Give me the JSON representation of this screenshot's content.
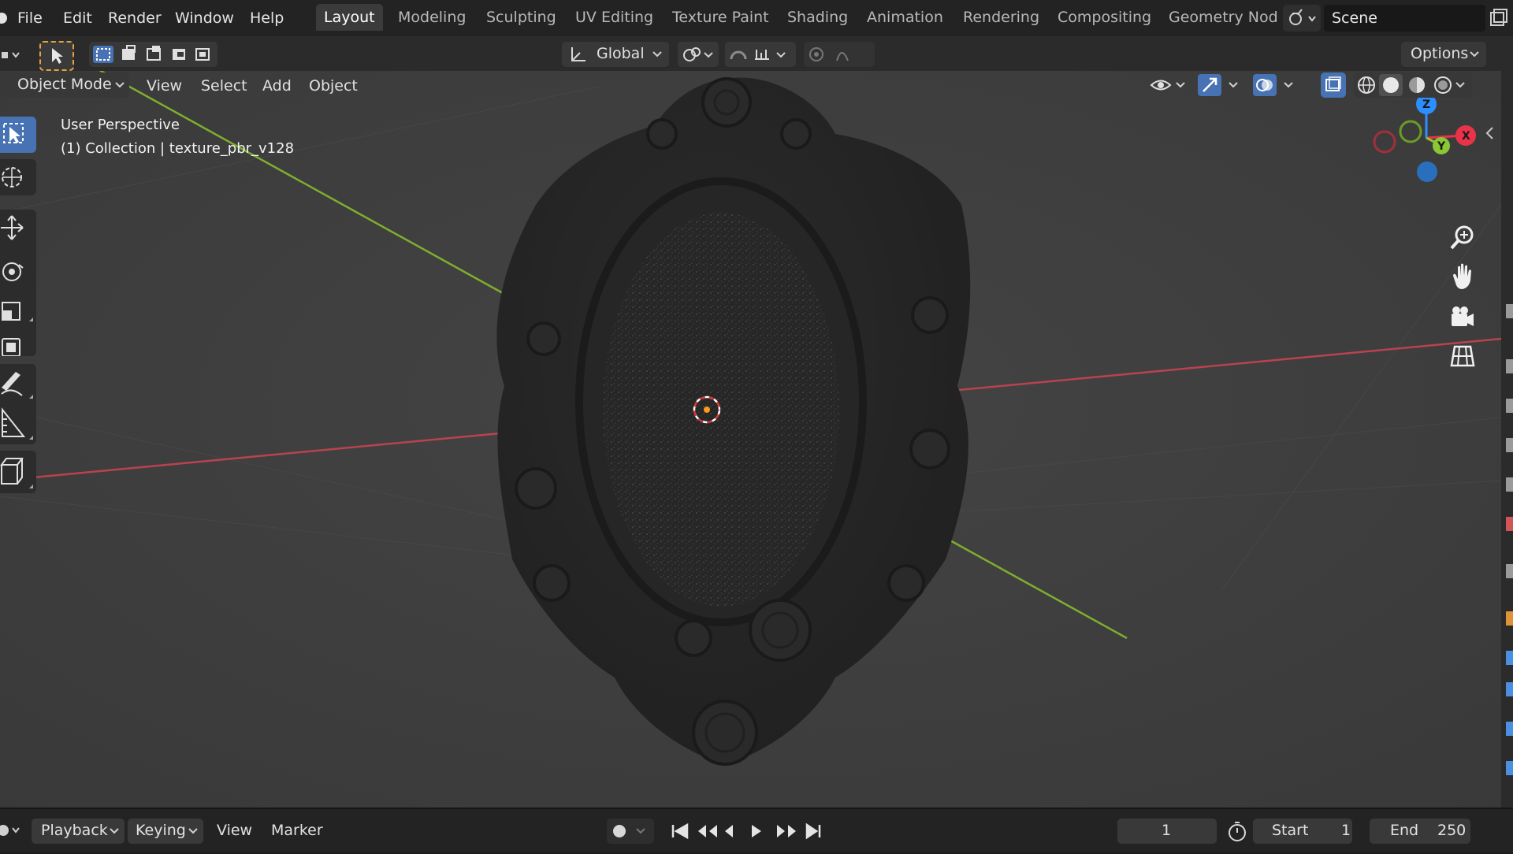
{
  "menu": {
    "items": [
      "File",
      "Edit",
      "Render",
      "Window",
      "Help"
    ]
  },
  "workspaces": {
    "tabs": [
      "Layout",
      "Modeling",
      "Sculpting",
      "UV Editing",
      "Texture Paint",
      "Shading",
      "Animation",
      "Rendering",
      "Compositing",
      "Geometry Nod"
    ],
    "active": "Layout"
  },
  "scene": {
    "label": "Scene"
  },
  "header": {
    "orientation": "Global",
    "options": "Options"
  },
  "viewport_header": {
    "mode": "Object Mode",
    "menus": [
      "View",
      "Select",
      "Add",
      "Object"
    ]
  },
  "overlay": {
    "view_name": "User Perspective",
    "collection_info": "(1) Collection | texture_pbr_v128"
  },
  "gizmo": {
    "axes": {
      "z": "Z",
      "y": "Y",
      "x": "X"
    },
    "colors": {
      "x": "#e8334a",
      "y": "#8bc734",
      "z": "#2c8fff",
      "neg_x": "#a0303d",
      "neg_z": "#2a6fbe"
    }
  },
  "timeline": {
    "menus": [
      "Playback",
      "Keying",
      "View",
      "Marker"
    ],
    "current_frame": "1",
    "start_label": "Start",
    "start_value": "1",
    "end_label": "End",
    "end_value": "250"
  },
  "colors": {
    "active_tab": "#3b3b3b",
    "accent": "#4772b3",
    "x_axis": "#c8404e",
    "y_axis": "#7fae2e",
    "origin": "#ff9a1f"
  }
}
